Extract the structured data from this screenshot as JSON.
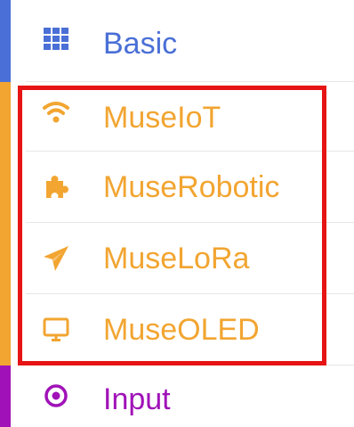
{
  "menu": {
    "items": [
      {
        "label": "Basic",
        "icon": "grid-icon",
        "color": "#4a6fd6"
      },
      {
        "label": "MuseIoT",
        "icon": "wifi-icon",
        "color": "#f2a531"
      },
      {
        "label": "MuseRobotic",
        "icon": "puzzle-icon",
        "color": "#f2a531"
      },
      {
        "label": "MuseLoRa",
        "icon": "paper-plane-icon",
        "color": "#f2a531"
      },
      {
        "label": "MuseOLED",
        "icon": "monitor-icon",
        "color": "#f2a531"
      },
      {
        "label": "Input",
        "icon": "radio-target-icon",
        "color": "#a012b8"
      }
    ]
  },
  "annotation": {
    "highlight_color": "#e61414"
  }
}
